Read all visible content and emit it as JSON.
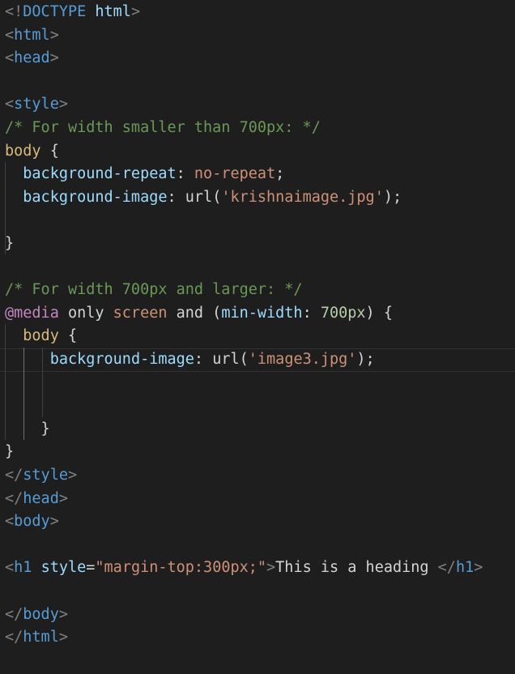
{
  "editor": {
    "theme": {
      "background": "#1e1e1e",
      "punct": "#808080",
      "tag": "#569cd6",
      "attr": "#9cdcfe",
      "string": "#ce9178",
      "comment": "#6a9955",
      "selector": "#d7ba7d",
      "text": "#d4d4d4",
      "number": "#b5cea8",
      "atrule": "#c586c0"
    },
    "lines": [
      [
        {
          "t": "<!",
          "c": "punct"
        },
        {
          "t": "DOCTYPE",
          "c": "tag"
        },
        {
          "t": " ",
          "c": "text"
        },
        {
          "t": "html",
          "c": "attr"
        },
        {
          "t": ">",
          "c": "punct"
        }
      ],
      [
        {
          "t": "<",
          "c": "punct"
        },
        {
          "t": "html",
          "c": "tag"
        },
        {
          "t": ">",
          "c": "punct"
        }
      ],
      [
        {
          "t": "<",
          "c": "punct"
        },
        {
          "t": "head",
          "c": "tag"
        },
        {
          "t": ">",
          "c": "punct"
        }
      ],
      [],
      [
        {
          "t": "<",
          "c": "punct"
        },
        {
          "t": "style",
          "c": "tag"
        },
        {
          "t": ">",
          "c": "punct"
        }
      ],
      [
        {
          "t": "/* For width smaller than 700px: */",
          "c": "comment"
        }
      ],
      [
        {
          "t": "body",
          "c": "selector"
        },
        {
          "t": " {",
          "c": "text"
        }
      ],
      [
        {
          "t": "  ",
          "c": "text"
        },
        {
          "t": "background-repeat",
          "c": "attr"
        },
        {
          "t": ": ",
          "c": "text"
        },
        {
          "t": "no-repeat",
          "c": "string"
        },
        {
          "t": ";",
          "c": "text"
        }
      ],
      [
        {
          "t": "  ",
          "c": "text"
        },
        {
          "t": "background-image",
          "c": "attr"
        },
        {
          "t": ": ",
          "c": "text"
        },
        {
          "t": "url(",
          "c": "text"
        },
        {
          "t": "'krishnaimage.jpg'",
          "c": "string"
        },
        {
          "t": ");",
          "c": "text"
        }
      ],
      [],
      [
        {
          "t": "}",
          "c": "text"
        }
      ],
      [],
      [
        {
          "t": "/* For width 700px and larger: */",
          "c": "comment"
        }
      ],
      [
        {
          "t": "@media",
          "c": "atrule"
        },
        {
          "t": " only ",
          "c": "text"
        },
        {
          "t": "screen",
          "c": "string"
        },
        {
          "t": " and (",
          "c": "text"
        },
        {
          "t": "min-width",
          "c": "attr"
        },
        {
          "t": ": ",
          "c": "text"
        },
        {
          "t": "700px",
          "c": "number"
        },
        {
          "t": ") {",
          "c": "text"
        }
      ],
      [
        {
          "t": "  ",
          "c": "text"
        },
        {
          "t": "body",
          "c": "selector"
        },
        {
          "t": " {",
          "c": "text"
        }
      ],
      [
        {
          "t": "     ",
          "c": "text"
        },
        {
          "t": "background-image",
          "c": "attr"
        },
        {
          "t": ": ",
          "c": "text"
        },
        {
          "t": "url(",
          "c": "text"
        },
        {
          "t": "'image3.jpg'",
          "c": "string"
        },
        {
          "t": ");",
          "c": "text"
        }
      ],
      [],
      [],
      [
        {
          "t": "    }",
          "c": "text"
        }
      ],
      [
        {
          "t": "}",
          "c": "text"
        }
      ],
      [
        {
          "t": "</",
          "c": "punct"
        },
        {
          "t": "style",
          "c": "tag"
        },
        {
          "t": ">",
          "c": "punct"
        }
      ],
      [
        {
          "t": "</",
          "c": "punct"
        },
        {
          "t": "head",
          "c": "tag"
        },
        {
          "t": ">",
          "c": "punct"
        }
      ],
      [
        {
          "t": "<",
          "c": "punct"
        },
        {
          "t": "body",
          "c": "tag"
        },
        {
          "t": ">",
          "c": "punct"
        }
      ],
      [],
      [
        {
          "t": "<",
          "c": "punct"
        },
        {
          "t": "h1",
          "c": "tag"
        },
        {
          "t": " ",
          "c": "text"
        },
        {
          "t": "style",
          "c": "attr"
        },
        {
          "t": "=",
          "c": "text"
        },
        {
          "t": "\"margin-top:300px;\"",
          "c": "string"
        },
        {
          "t": ">",
          "c": "punct"
        },
        {
          "t": "This is a heading ",
          "c": "text"
        },
        {
          "t": "</",
          "c": "punct"
        },
        {
          "t": "h1",
          "c": "tag"
        },
        {
          "t": ">",
          "c": "punct"
        }
      ],
      [],
      [
        {
          "t": "</",
          "c": "punct"
        },
        {
          "t": "body",
          "c": "tag"
        },
        {
          "t": ">",
          "c": "punct"
        }
      ],
      [
        {
          "t": "</",
          "c": "punct"
        },
        {
          "t": "html",
          "c": "tag"
        },
        {
          "t": ">",
          "c": "punct"
        }
      ]
    ],
    "current_line": 15
  }
}
